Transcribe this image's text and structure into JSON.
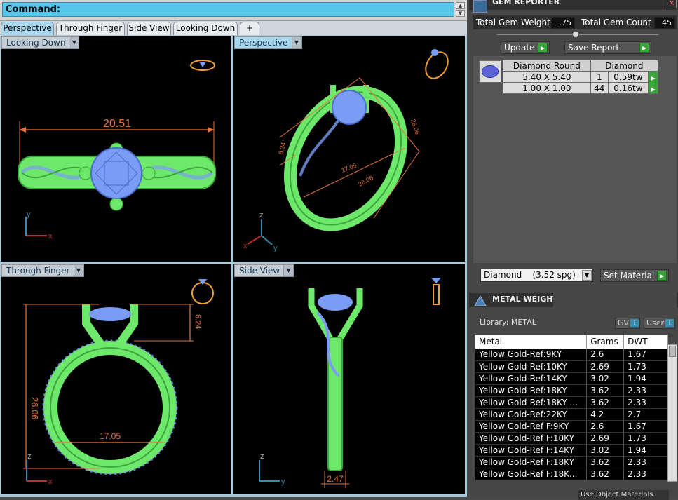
{
  "command": {
    "label": "Command:"
  },
  "tabs": [
    {
      "label": "Perspective",
      "active": true
    },
    {
      "label": "Through Finger"
    },
    {
      "label": "Side View"
    },
    {
      "label": "Looking Down"
    },
    {
      "label": "+"
    }
  ],
  "viewports": {
    "top_left": {
      "label": "Looking Down",
      "dimension": "20.51",
      "axis_y": "y",
      "axis_x": "x"
    },
    "top_right": {
      "label": "Perspective",
      "dim_a": "6.24",
      "dim_b": "17.05",
      "dim_c": "26.06",
      "dim_d": "26.06",
      "axis_z": "z",
      "axis_x": "x",
      "axis_y": "y"
    },
    "bottom_left": {
      "label": "Through Finger",
      "dim_height": "26.06",
      "dim_width": "17.05",
      "dim_head": "6.24",
      "axis_z": "z",
      "axis_x": "x"
    },
    "bottom_right": {
      "label": "Side View",
      "dim_width": "2.47",
      "axis_z": "z",
      "axis_y": "y"
    }
  },
  "gem_reporter": {
    "title": "GEM REPORTER",
    "total_weight_label": "Total Gem Weight",
    "total_weight_value": ".75",
    "total_count_label": "Total Gem Count",
    "total_count_value": "45",
    "update_label": "Update",
    "save_report_label": "Save Report",
    "columns": [
      "Diamond Round",
      "Diamond"
    ],
    "rows": [
      {
        "size": "5.40 X 5.40",
        "count": "1",
        "weight": "0.59tw"
      },
      {
        "size": "1.00 X 1.00",
        "count": "44",
        "weight": "0.16tw"
      }
    ],
    "material_select": "Diamond    (3.52 spg)",
    "set_material_label": "Set Material"
  },
  "metal_weights": {
    "title": "METAL WEIGHTS",
    "library_label": "Library: METAL",
    "gv_label": "GV",
    "user_label": "User",
    "columns": [
      "Metal",
      "Grams",
      "DWT"
    ],
    "rows": [
      {
        "metal": "Yellow Gold-Ref:9KY",
        "grams": "2.6",
        "dwt": "1.67"
      },
      {
        "metal": "Yellow Gold-Ref:10KY",
        "grams": "2.69",
        "dwt": "1.73"
      },
      {
        "metal": "Yellow Gold-Ref:14KY",
        "grams": "3.02",
        "dwt": "1.94"
      },
      {
        "metal": "Yellow Gold-Ref:18KY",
        "grams": "3.62",
        "dwt": "2.33"
      },
      {
        "metal": "Yellow Gold-Ref:18KY ...",
        "grams": "3.62",
        "dwt": "2.33"
      },
      {
        "metal": "Yellow Gold-Ref:22KY",
        "grams": "4.2",
        "dwt": "2.7"
      },
      {
        "metal": "Yellow Gold-Ref F:9KY",
        "grams": "2.6",
        "dwt": "1.67"
      },
      {
        "metal": "Yellow Gold-Ref F:10KY",
        "grams": "2.69",
        "dwt": "1.73"
      },
      {
        "metal": "Yellow Gold-Ref F:14KY",
        "grams": "3.02",
        "dwt": "1.94"
      },
      {
        "metal": "Yellow Gold-Ref F:18KY",
        "grams": "3.62",
        "dwt": "2.33"
      },
      {
        "metal": "Yellow Gold-Ref F:18K...",
        "grams": "3.62",
        "dwt": "2.33"
      }
    ],
    "use_object_materials": "Use Object Materials"
  },
  "colors": {
    "ring": "#7ef07a",
    "gem": "#7b9cf5",
    "dimension": "#e8743a",
    "accent": "#55c8ea"
  }
}
